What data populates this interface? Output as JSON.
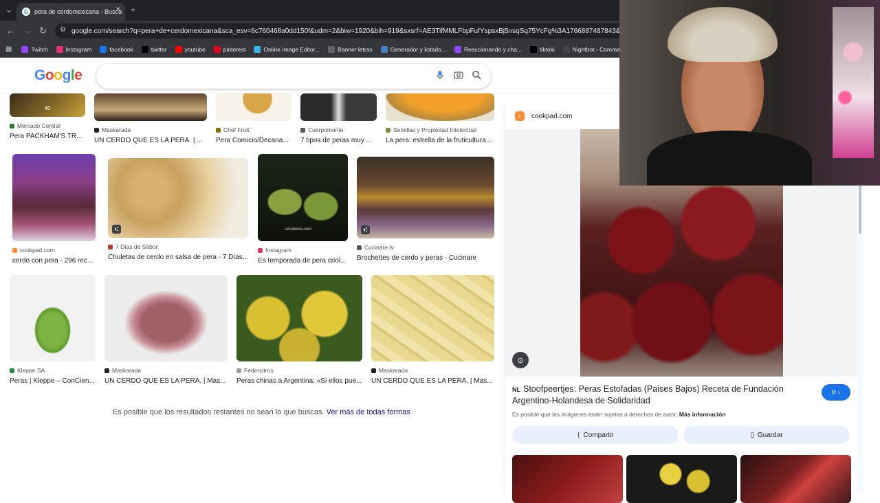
{
  "browser": {
    "tab_title": "pera de cerdomexicana - Busca",
    "new_tab": "+",
    "url": "google.com/search?q=pera+de+cerdomexicana&sca_esv=6c760468a0dd150f&udm=2&biw=1920&bih=919&sxsrf=AE3TifMMLFbpFufYspsxBj5nsqSq75YcFg%3A1766887487843&ei=P5BQaeyN",
    "bookmarks": [
      {
        "label": "Twitch",
        "color": "#9146ff"
      },
      {
        "label": "Instagram",
        "color": "#e1306c"
      },
      {
        "label": "facebook",
        "color": "#1877f2"
      },
      {
        "label": "twitter",
        "color": "#000000"
      },
      {
        "label": "youtube",
        "color": "#ff0000"
      },
      {
        "label": "pinterest",
        "color": "#e60023"
      },
      {
        "label": "Online Image Editor...",
        "color": "#33b5e5"
      },
      {
        "label": "Banner letras",
        "color": "#5f6368"
      },
      {
        "label": "Generador y listado...",
        "color": "#3f7fbf"
      },
      {
        "label": "Reaccionando y cha...",
        "color": "#9146ff"
      },
      {
        "label": "tiktoki",
        "color": "#000000"
      },
      {
        "label": "Nightbot - Comma...",
        "color": "#444444"
      }
    ]
  },
  "google": {
    "logo": "Google",
    "search_value": ""
  },
  "results": {
    "row0": [
      {
        "source": "Mercado Central",
        "title": "Pera PACKHAM'S TR...",
        "color": "#2e7d32"
      },
      {
        "source": "Maskarada",
        "title": "UN CERDO QUE ES LA PERA. | ...",
        "color": "#222222"
      },
      {
        "source": "Chef Fruit",
        "title": "Pera Comicio/Decana...",
        "color": "#8d6e00"
      },
      {
        "source": "Cuerpomente",
        "title": "7 tipos de peras muy ...",
        "color": "#555555"
      },
      {
        "source": "Semillas y Propiedad Intelectual",
        "title": "La pera: estrella de la fruticultura...",
        "color": "#7b8c3a"
      }
    ],
    "row1": [
      {
        "source": "cookpad.com",
        "title": "cerdo con pera - 296 recet...",
        "color": "#ff8c2e"
      },
      {
        "source": "7 Días de Sabor",
        "title": "Chuletas de cerdo en salsa de pera - 7 Días...",
        "color": "#c0392b"
      },
      {
        "source": "Instagram",
        "title": "Es temporada de pera criol...",
        "color": "#e1306c"
      },
      {
        "source": "Cucinare.tv",
        "title": "Brochettes de cerdo y peras - Cucinare",
        "color": "#555555"
      }
    ],
    "row2": [
      {
        "source": "Kleppe SA",
        "title": "Peras | Kleppe – ConCien...",
        "color": "#1e8e3e"
      },
      {
        "source": "Maskarada",
        "title": "UN CERDO QUE ES LA PERA. | Mas...",
        "color": "#222222"
      },
      {
        "source": "Federcitrus",
        "title": "Peras chinas a Argentina: «Si ellos pue...",
        "color": "#9e9e9e"
      },
      {
        "source": "Maskarada",
        "title": "UN CERDO QUE ES LA PERA. | Mas...",
        "color": "#222222"
      }
    ],
    "note": "Es posible que los resultados restantes no sean lo que buscas.",
    "note_link": "Ver más de todas formas",
    "badge_text": "40",
    "overlay_text": "arcatierra.com"
  },
  "panel": {
    "source": "cookpad.com",
    "lang": "NL",
    "title": "Stoofpeertjes: Peras Estofadas (Paises Bajos) Receta de Fundación Argentino-Holandesa de Solidaridad",
    "go_button": "Ir",
    "copyright": "Es posible que las imágenes estén sujetas a derechos de autor.",
    "more_info": "Más información",
    "share": "Compartir",
    "save": "Guardar"
  }
}
